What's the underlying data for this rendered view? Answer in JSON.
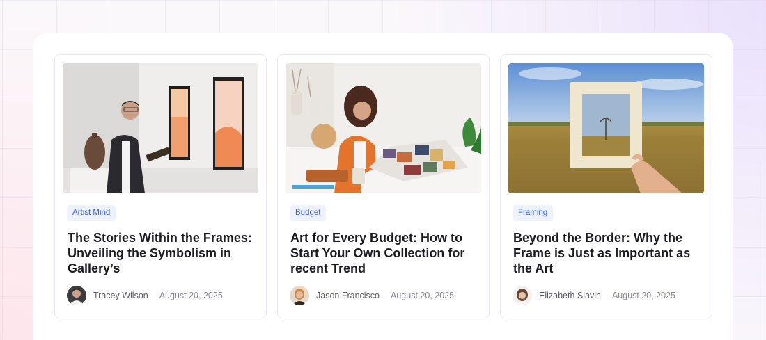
{
  "posts": [
    {
      "category": "Artist Mind",
      "title": "The Stories Within the Frames: Unveiling the Symbolism in Gallery’s",
      "author": "Tracey Wilson",
      "date": "August 20, 2025",
      "image": "man-viewing-gallery-art-photo"
    },
    {
      "category": "Budget",
      "title": "Art for Every Budget: How to Start Your Own Collection for recent Trend",
      "author": "Jason Francisco",
      "date": "August 20, 2025",
      "image": "woman-arranging-collage-photo"
    },
    {
      "category": "Framing",
      "title": "Beyond the Border: Why the Frame is Just as Important as the Art",
      "author": "Elizabeth Slavin",
      "date": "August 20, 2025",
      "image": "hand-holding-frame-field-photo"
    }
  ],
  "colors": {
    "tag_background": "#eef2fc",
    "tag_text": "#3d5fd1",
    "title_text": "#1d1b22",
    "meta_text": "#8a8792"
  }
}
